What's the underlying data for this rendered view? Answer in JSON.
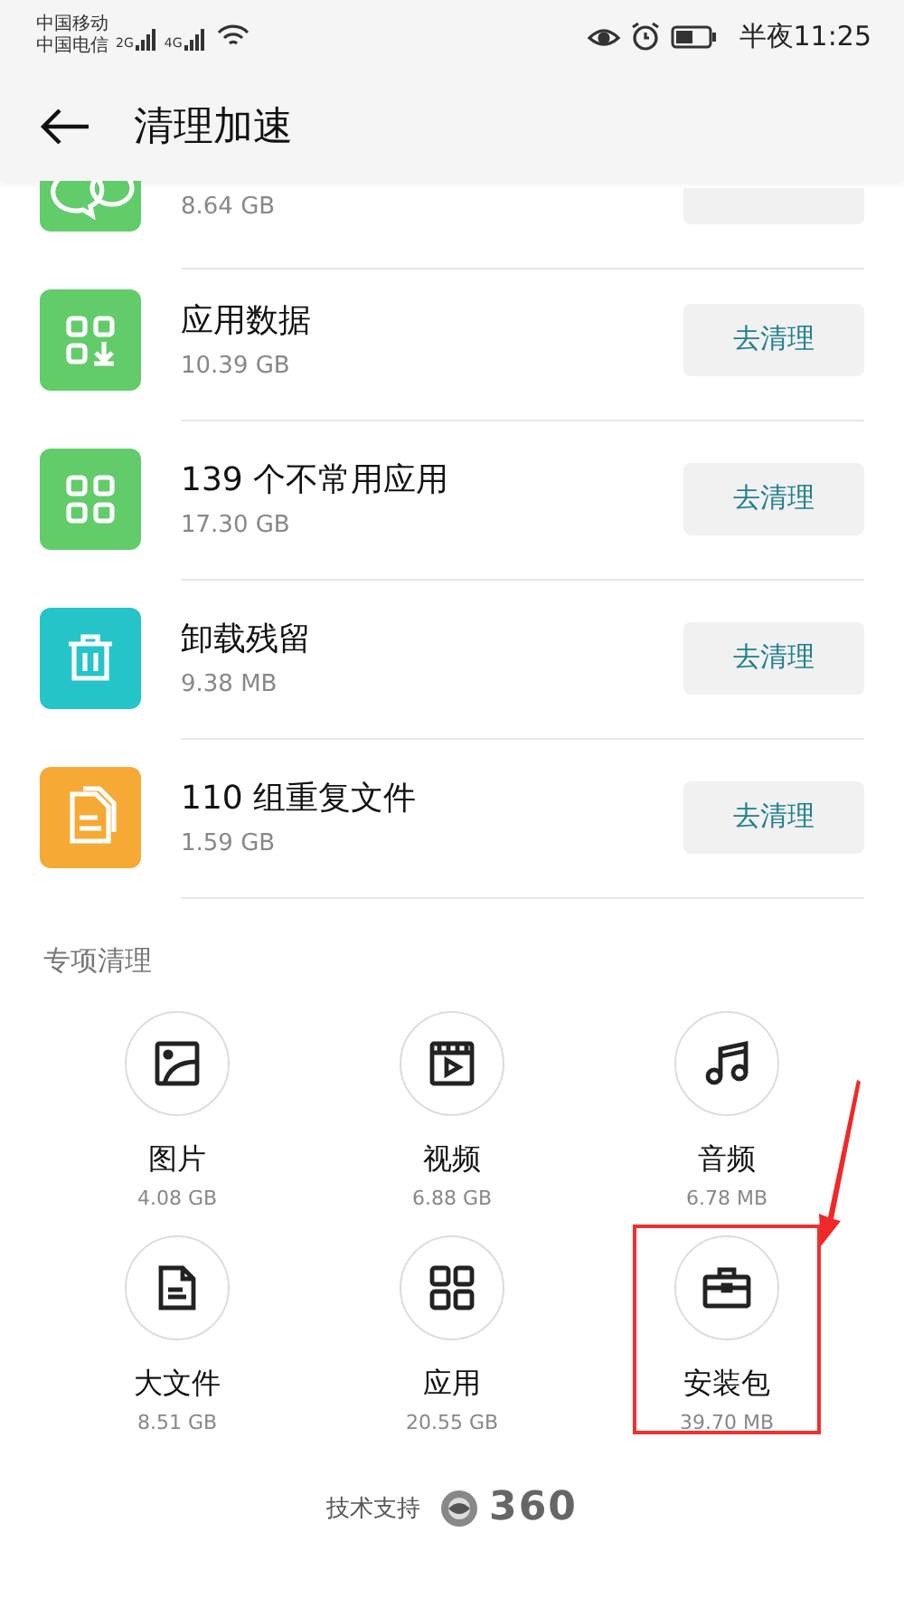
{
  "status_bar": {
    "carriers": [
      "中国移动",
      "中国电信"
    ],
    "networks": [
      "2G",
      "4G"
    ],
    "time": "半夜11:25"
  },
  "header": {
    "title": "清理加速"
  },
  "cleanup_items": [
    {
      "kind": "partial-chat",
      "color": "#62cc6a",
      "size": "8.64 GB"
    },
    {
      "kind": "app-data",
      "color": "#62cc6a",
      "title": "应用数据",
      "size": "10.39 GB",
      "button": "去清理"
    },
    {
      "kind": "grid",
      "color": "#62cc6a",
      "title": "139 个不常用应用",
      "size": "17.30 GB",
      "button": "去清理"
    },
    {
      "kind": "trash",
      "color": "#25c4c9",
      "title": "卸载残留",
      "size": "9.38 MB",
      "button": "去清理"
    },
    {
      "kind": "file",
      "color": "#f6a935",
      "title": "110 组重复文件",
      "size": "1.59 GB",
      "button": "去清理"
    }
  ],
  "section_title": "专项清理",
  "special_items": [
    {
      "kind": "image",
      "label": "图片",
      "size": "4.08 GB",
      "highlighted": false
    },
    {
      "kind": "video",
      "label": "视频",
      "size": "6.88 GB",
      "highlighted": false
    },
    {
      "kind": "music",
      "label": "音频",
      "size": "6.78 MB",
      "highlighted": false
    },
    {
      "kind": "document",
      "label": "大文件",
      "size": "8.51 GB",
      "highlighted": false
    },
    {
      "kind": "grid",
      "label": "应用",
      "size": "20.55 GB",
      "highlighted": false
    },
    {
      "kind": "briefcase",
      "label": "安装包",
      "size": "39.70 MB",
      "highlighted": true
    }
  ],
  "footer": {
    "text": "技术支持",
    "brand": "360"
  }
}
